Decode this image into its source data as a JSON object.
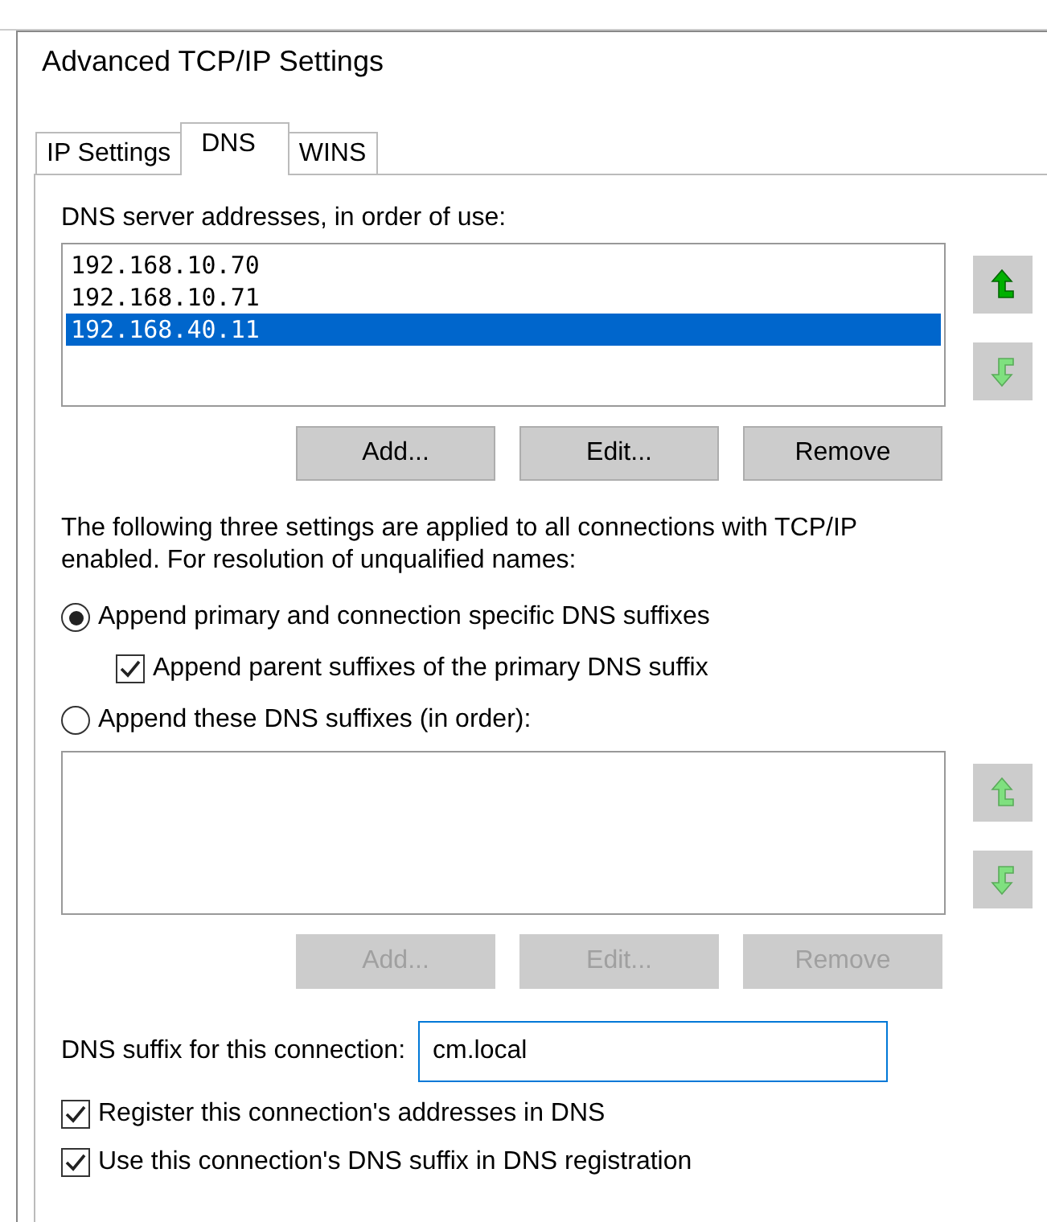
{
  "window": {
    "title": "Advanced TCP/IP Settings"
  },
  "tabs": [
    {
      "label": "IP Settings",
      "selected": false
    },
    {
      "label": "DNS",
      "selected": true
    },
    {
      "label": "WINS",
      "selected": false
    }
  ],
  "dns_servers": {
    "label": "DNS server addresses, in order of use:",
    "items": [
      {
        "text": "192.168.10.70",
        "selected": false
      },
      {
        "text": "192.168.10.71",
        "selected": false
      },
      {
        "text": "192.168.40.11",
        "selected": true
      }
    ],
    "move_buttons": [
      {
        "kind": "up",
        "disabled": false
      },
      {
        "kind": "down",
        "disabled": true
      }
    ],
    "buttons": [
      {
        "label": "Add...",
        "disabled": false
      },
      {
        "label": "Edit...",
        "disabled": false
      },
      {
        "label": "Remove",
        "disabled": false
      }
    ]
  },
  "description": "The following three settings are applied to all connections with TCP/IP enabled. For resolution of unqualified names:",
  "options": [
    {
      "kind": "radio",
      "label": "Append primary and connection specific DNS suffixes",
      "selected": true,
      "children": [
        {
          "kind": "checkbox",
          "label": "Append parent suffixes of the primary DNS suffix",
          "checked": true
        }
      ]
    },
    {
      "kind": "radio",
      "label": "Append these DNS suffixes (in order):",
      "selected": false
    }
  ],
  "suffix_list": {
    "move_buttons": [
      {
        "kind": "up",
        "disabled": true
      },
      {
        "kind": "down",
        "disabled": true
      }
    ],
    "buttons": [
      {
        "label": "Add...",
        "disabled": true
      },
      {
        "label": "Edit...",
        "disabled": true
      },
      {
        "label": "Remove",
        "disabled": true
      }
    ]
  },
  "suffix_field": {
    "label": "DNS suffix for this connection:",
    "value": "cm.local",
    "focused": true
  },
  "registration": [
    {
      "label": "Register this connection's addresses in DNS",
      "checked": true
    },
    {
      "label": "Use this connection's DNS suffix in DNS registration",
      "checked": true
    }
  ]
}
